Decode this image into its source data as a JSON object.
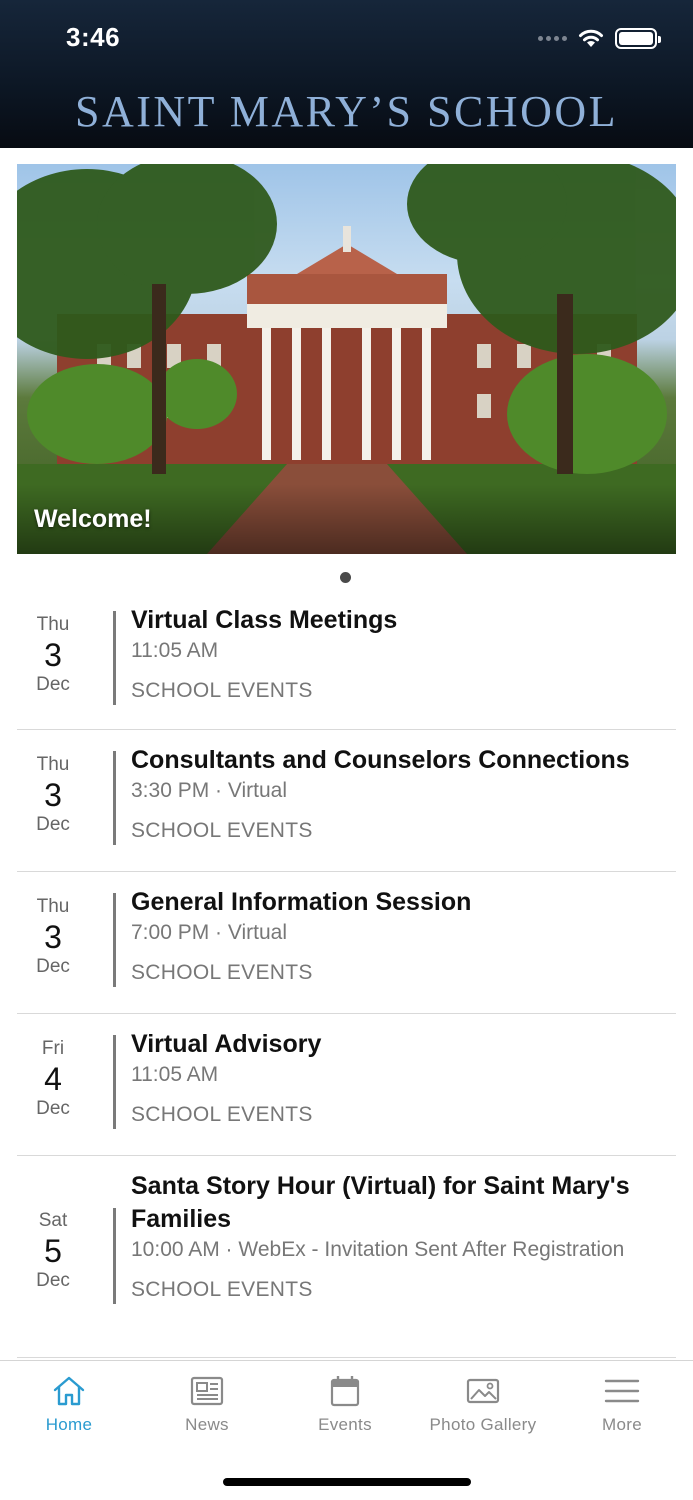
{
  "status_bar": {
    "time": "3:46"
  },
  "header": {
    "title": "SAINT MARY’S SCHOOL"
  },
  "hero": {
    "caption": "Welcome!"
  },
  "events": [
    {
      "dow": "Thu",
      "day": "3",
      "month": "Dec",
      "title": "Virtual Class Meetings",
      "meta": "11:05 AM",
      "category": "SCHOOL EVENTS"
    },
    {
      "dow": "Thu",
      "day": "3",
      "month": "Dec",
      "title": "Consultants and Counselors Connections",
      "meta": "3:30 PM · Virtual",
      "category": "SCHOOL EVENTS"
    },
    {
      "dow": "Thu",
      "day": "3",
      "month": "Dec",
      "title": "General Information Session",
      "meta": "7:00 PM · Virtual",
      "category": "SCHOOL EVENTS"
    },
    {
      "dow": "Fri",
      "day": "4",
      "month": "Dec",
      "title": "Virtual Advisory",
      "meta": "11:05 AM",
      "category": "SCHOOL EVENTS"
    },
    {
      "dow": "Sat",
      "day": "5",
      "month": "Dec",
      "title": "Santa Story Hour (Virtual) for Saint Mary's Families",
      "meta": "10:00 AM · WebEx - Invitation Sent After Registration",
      "category": "SCHOOL EVENTS"
    }
  ],
  "tabs": [
    {
      "label": "Home",
      "icon": "home-icon",
      "active": true
    },
    {
      "label": "News",
      "icon": "newspaper-icon"
    },
    {
      "label": "Events",
      "icon": "calendar-icon"
    },
    {
      "label": "Photo Gallery",
      "icon": "image-icon"
    },
    {
      "label": "More",
      "icon": "menu-icon"
    }
  ],
  "colors": {
    "accent": "#2a9bd0",
    "header_title": "#8fb0d8",
    "header_bg": "#0d1826"
  }
}
